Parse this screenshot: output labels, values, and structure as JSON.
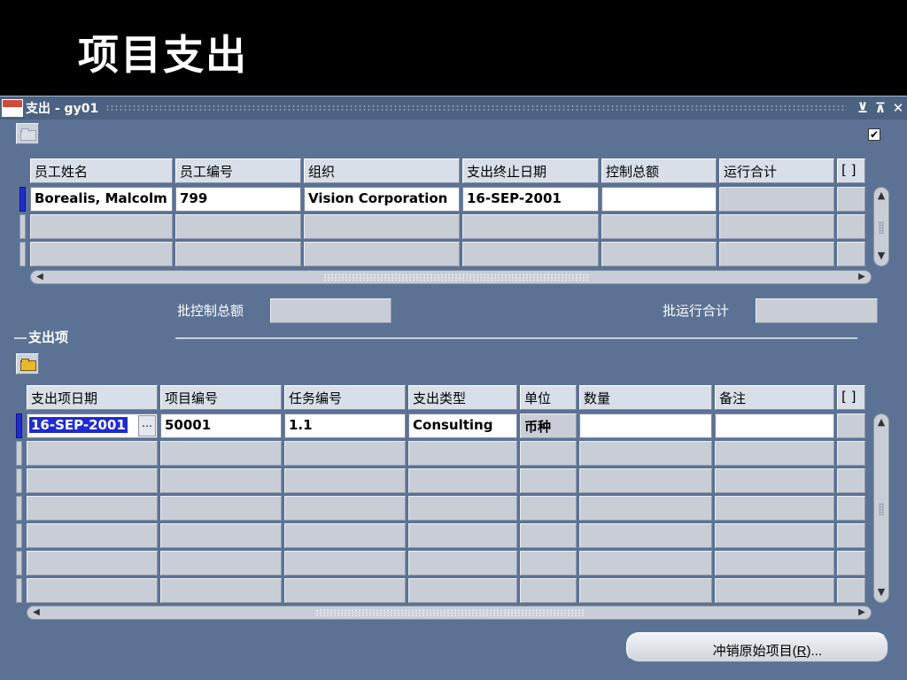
{
  "slide": {
    "title": "项目支出"
  },
  "window": {
    "title": "支出 - gy01",
    "controls": {
      "minimize": "⊻",
      "maximize": "⊼",
      "close": "✕"
    },
    "checkbox_mark": "✔"
  },
  "header_block": {
    "columns": [
      "员工姓名",
      "员工编号",
      "组织",
      "支出终止日期",
      "控制总额",
      "运行合计",
      "[ ]"
    ],
    "rows": [
      [
        "Borealis, Malcolm",
        "799",
        "Vision Corporation",
        "16-SEP-2001",
        "",
        ""
      ],
      [
        "",
        "",
        "",
        "",
        "",
        ""
      ],
      [
        "",
        "",
        "",
        "",
        "",
        ""
      ]
    ]
  },
  "batch": {
    "control_total_label": "批控制总额",
    "running_total_label": "批运行合计",
    "control_total_value": "",
    "running_total_value": ""
  },
  "items_section": {
    "title": "支出项",
    "columns": [
      "支出项日期",
      "项目编号",
      "任务编号",
      "支出类型",
      "单位",
      "数量",
      "备注",
      "[ ]"
    ],
    "rows": [
      [
        "16-SEP-2001",
        "50001",
        "1.1",
        "Consulting",
        "币种",
        "",
        ""
      ],
      [
        "",
        "",
        "",
        "",
        "",
        "",
        ""
      ],
      [
        "",
        "",
        "",
        "",
        "",
        "",
        ""
      ],
      [
        "",
        "",
        "",
        "",
        "",
        "",
        ""
      ],
      [
        "",
        "",
        "",
        "",
        "",
        "",
        ""
      ],
      [
        "",
        "",
        "",
        "",
        "",
        "",
        ""
      ],
      [
        "",
        "",
        "",
        "",
        "",
        "",
        ""
      ]
    ],
    "lov_label": "…"
  },
  "actions": {
    "reverse_button_text": "冲销原始项目(",
    "reverse_button_key": "R",
    "reverse_button_suffix": ")..."
  },
  "colors": {
    "window_bg": "#5b7294",
    "current_row_indicator": "#1f2bd0",
    "cell_bg": "#c9ced6"
  }
}
